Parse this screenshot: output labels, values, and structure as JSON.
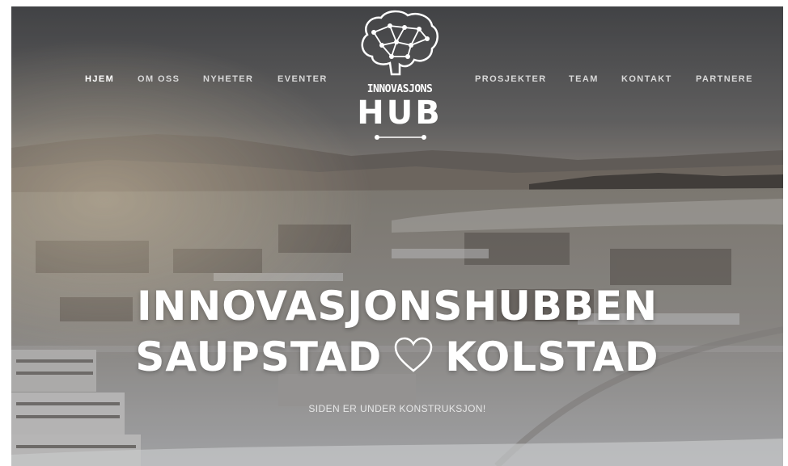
{
  "nav": {
    "left": [
      {
        "label": "HJEM",
        "active": true
      },
      {
        "label": "OM OSS"
      },
      {
        "label": "NYHETER"
      },
      {
        "label": "EVENTER"
      }
    ],
    "right": [
      {
        "label": "PROSJEKTER"
      },
      {
        "label": "TEAM"
      },
      {
        "label": "KONTAKT"
      },
      {
        "label": "PARTNERE"
      }
    ]
  },
  "logo": {
    "line1": "INNOVASJONS",
    "line2": "HUB"
  },
  "hero": {
    "title_line1": "INNOVASJONSHUBBEN",
    "title_line2_left": "SAUPSTAD",
    "title_line2_right": "KOLSTAD",
    "subtitle": "SIDEN ER UNDER KONSTRUKSJON!"
  }
}
